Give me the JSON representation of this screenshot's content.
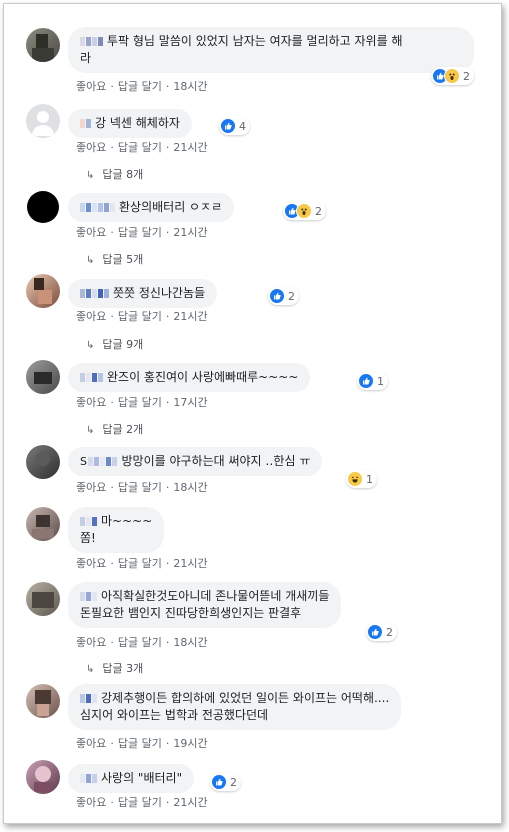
{
  "actions": {
    "like": "좋아요",
    "reply": "답글 달기",
    "sep": "·"
  },
  "colors": {
    "like_blue": "#1877f2",
    "wow_yellow": "#f7c946",
    "name_blue": "#385898"
  },
  "comments": [
    {
      "text": "투팍 형님 말씀이 있었지 남자는 여자를 멀리하고 자위를 해라",
      "line1": "투팍 형님 말씀이 있었지 남자는 여자를 멀리하고 자위를 해",
      "line2": "라",
      "time": "18시간",
      "reactions": [
        "like",
        "wow"
      ],
      "count": "2"
    },
    {
      "text": "강 넥센 해체하자",
      "time": "21시간",
      "reactions": [
        "like"
      ],
      "count": "4",
      "replies": "답글 8개"
    },
    {
      "text": "환상의배터리 ㅇㅈㄹ",
      "time": "21시간",
      "reactions": [
        "like",
        "wow"
      ],
      "count": "2",
      "replies": "답글 5개"
    },
    {
      "text": "쯧쯧 정신나간놈들",
      "time": "21시간",
      "reactions": [
        "like"
      ],
      "count": "2",
      "replies": "답글 9개"
    },
    {
      "text": "완즈이 홍진여이 사랑에빠때루~~~~",
      "time": "17시간",
      "reactions": [
        "like"
      ],
      "count": "1",
      "replies": "답글 2개"
    },
    {
      "text": "방망이를 야구하는대 써야지 ‥한심 ㅠ",
      "time": "18시간",
      "reactions": [
        "haha"
      ],
      "count": "1"
    },
    {
      "line1": "마~~~~",
      "line2": "쫌!",
      "time": "21시간"
    },
    {
      "line1": "아직확실한것도아니데 존나물어뜯네 개새끼들",
      "line2": "돈필요한 뱀인지 진따당한희생인지는 판결후",
      "time": "18시간",
      "reactions": [
        "like"
      ],
      "count": "2",
      "replies": "답글 3개"
    },
    {
      "line1": "강제추행이든 합의하에 있었던 일이든 와이프는 어떡해....",
      "line2": "심지어 와이프는 법학과 전공했다던데",
      "time": "19시간"
    },
    {
      "text": "사랑의 \"배터리\"",
      "time": "21시간",
      "reactions": [
        "like"
      ],
      "count": "2"
    }
  ]
}
